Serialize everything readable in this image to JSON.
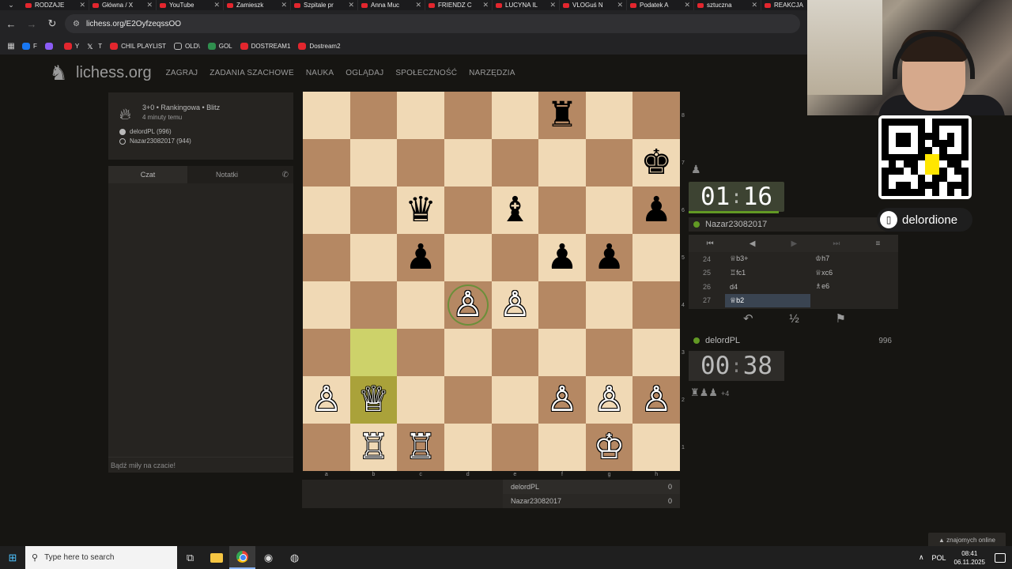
{
  "browser": {
    "tabs": [
      "RODZAJE",
      "Główna / X",
      "YouTube",
      "Zamieszk",
      "Szpitale pr",
      "Anna Muc",
      "FRIENDZ C",
      "LUCYNA IL",
      "VLOGuś N",
      "Podatek A",
      "sztuczna",
      "REAKCJA"
    ],
    "url": "lichess.org/E2OyfzeqssOO",
    "bookmarks": [
      "F",
      "Y",
      "T",
      "CHIL PLAYLIST",
      "OLD\\",
      "GOL",
      "DOSTREAM1",
      "Dostream2"
    ]
  },
  "site": {
    "logo": "lichess.org",
    "nav": [
      "ZAGRAJ",
      "ZADANIA SZACHOWE",
      "NAUKA",
      "OGLĄDAJ",
      "SPOŁECZNOŚĆ",
      "NARZĘDZIA"
    ]
  },
  "game_info": {
    "title": "3+0 • Rankingowa • Blitz",
    "time_ago": "4 minuty temu",
    "white_player": "delordPL (996)",
    "black_player": "Nazar23082017 (944)"
  },
  "chat": {
    "tab_chat": "Czat",
    "tab_notes": "Notatki",
    "placeholder": "Bądź miły na czacie!"
  },
  "board": {
    "ranks": [
      "8",
      "7",
      "6",
      "5",
      "4",
      "3",
      "2",
      "1"
    ],
    "files": [
      "a",
      "b",
      "c",
      "d",
      "e",
      "f",
      "g",
      "h"
    ],
    "squares": [
      [
        "",
        "",
        "",
        "",
        "",
        "♜b",
        "",
        ""
      ],
      [
        "",
        "",
        "",
        "",
        "",
        "",
        "",
        "♚b"
      ],
      [
        "",
        "",
        "♛b",
        "",
        "♝b",
        "",
        "",
        "♟b"
      ],
      [
        "",
        "",
        "♟b",
        "",
        "",
        "♟b",
        "♟b",
        ""
      ],
      [
        "",
        "",
        "",
        "♙w",
        "♙w",
        "",
        "",
        ""
      ],
      [
        "",
        "",
        "",
        "",
        "",
        "",
        "",
        ""
      ],
      [
        "♙w",
        "♕w",
        "",
        "",
        "",
        "♙w",
        "♙w",
        "♙w"
      ],
      [
        "",
        "♖w",
        "♖w",
        "",
        "",
        "",
        "♔w",
        ""
      ]
    ],
    "highlight_squares": [
      "b3",
      "b2"
    ],
    "ring_square": "d4"
  },
  "scoreboard": [
    {
      "name": "delordPL",
      "score": "0"
    },
    {
      "name": "Nazar23082017",
      "score": "0"
    }
  ],
  "opponent": {
    "name": "Nazar23082017",
    "clock_min": "01",
    "clock_sec": "16",
    "captured_icon": "♟"
  },
  "player": {
    "name": "delordPL",
    "rating": "996",
    "clock_min": "00",
    "clock_sec": "38",
    "material_icons": "♜♟♟",
    "material_diff": "+4"
  },
  "moves": [
    {
      "num": "24",
      "white": "♕b3+",
      "black": "♔h7"
    },
    {
      "num": "25",
      "white": "♖fc1",
      "black": "♕xc6"
    },
    {
      "num": "26",
      "white": "d4",
      "black": "♗e6"
    },
    {
      "num": "27",
      "white": "♕b2",
      "black": ""
    }
  ],
  "move_controls": [
    "⏮",
    "◀",
    "▶",
    "⏭",
    "≡"
  ],
  "actions": [
    "↶",
    "½",
    "⚑"
  ],
  "overlay": {
    "social_handle": "delordione",
    "friends_online": "▲ znajomych online"
  },
  "taskbar": {
    "search_placeholder": "Type here to search",
    "lang": "POL",
    "time": "08:41",
    "date": "06.11.2025"
  }
}
